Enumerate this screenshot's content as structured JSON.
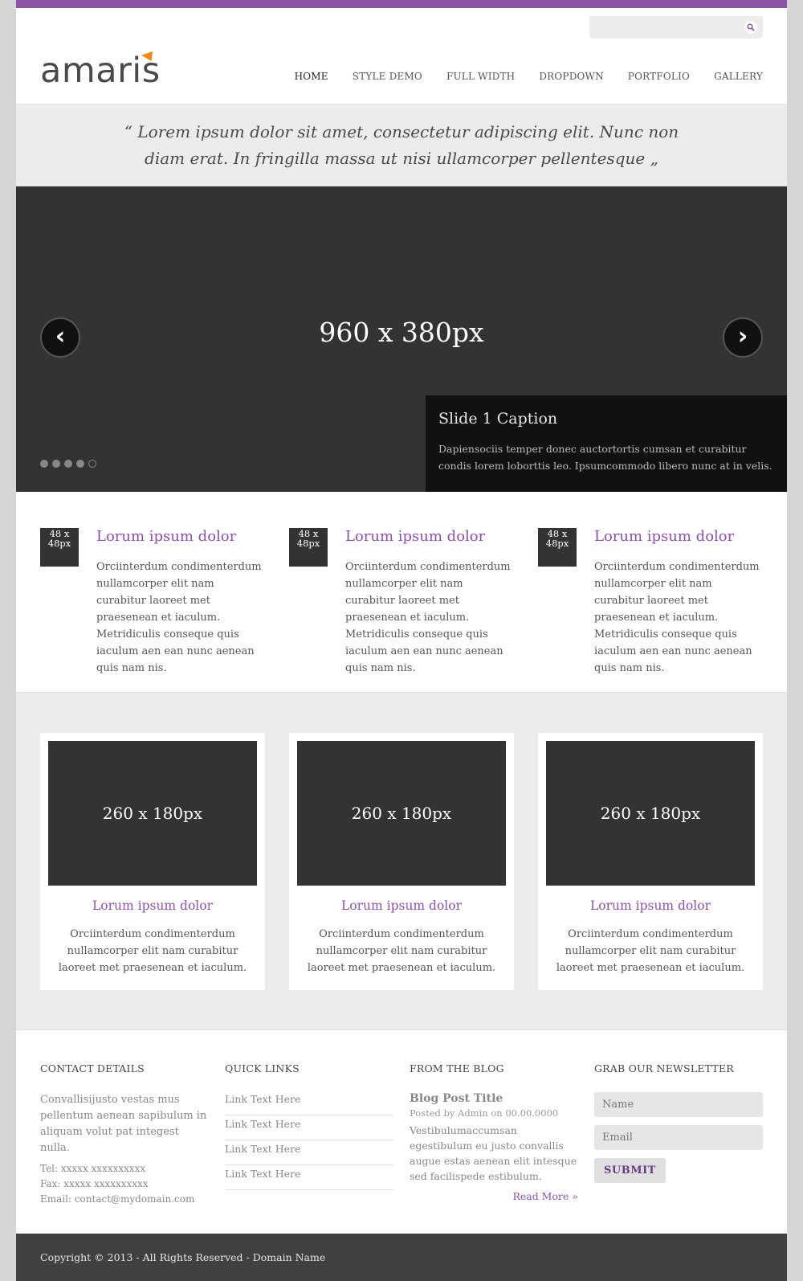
{
  "header": {
    "logo_text": "amaris",
    "nav": [
      "HOME",
      "STYLE DEMO",
      "FULL WIDTH",
      "DROPDOWN",
      "PORTFOLIO",
      "GALLERY"
    ],
    "active_nav": "HOME"
  },
  "quote": "“ Lorem ipsum dolor sit amet, consectetur adipiscing elit. Nunc non diam erat. In fringilla massa ut nisi ullamcorper pellentesque „",
  "slider": {
    "image_label": "960 x 380px",
    "caption_title": "Slide 1 Caption",
    "caption_text": "Dapiensociis temper donec auctortortis cumsan et curabitur condis lorem loborttis leo. Ipsumcommodo libero nunc at in velis.",
    "prev_glyph": "‹",
    "next_glyph": "›",
    "dot_count": 5,
    "active_dot": 5
  },
  "features": [
    {
      "thumb": "48 x 48px",
      "title": "Lorum ipsum dolor",
      "text": "Orciinterdum condimenterdum nullamcorper elit nam curabitur laoreet met praesenean et iaculum. Metridiculis conseque quis iaculum aen ean nunc aenean quis nam nis."
    },
    {
      "thumb": "48 x 48px",
      "title": "Lorum ipsum dolor",
      "text": "Orciinterdum condimenterdum nullamcorper elit nam curabitur laoreet met praesenean et iaculum. Metridiculis conseque quis iaculum aen ean nunc aenean quis nam nis."
    },
    {
      "thumb": "48 x 48px",
      "title": "Lorum ipsum dolor",
      "text": "Orciinterdum condimenterdum nullamcorper elit nam curabitur laoreet met praesenean et iaculum. Metridiculis conseque quis iaculum aen ean nunc aenean quis nam nis."
    }
  ],
  "portfolio": [
    {
      "image_label": "260 x 180px",
      "title": "Lorum ipsum dolor",
      "text": "Orciinterdum condimenterdum nullamcorper elit nam curabitur laoreet met praesenean et iaculum."
    },
    {
      "image_label": "260 x 180px",
      "title": "Lorum ipsum dolor",
      "text": "Orciinterdum condimenterdum nullamcorper elit nam curabitur laoreet met praesenean et iaculum."
    },
    {
      "image_label": "260 x 180px",
      "title": "Lorum ipsum dolor",
      "text": "Orciinterdum condimenterdum nullamcorper elit nam curabitur laoreet met praesenean et iaculum."
    }
  ],
  "footer": {
    "contact": {
      "heading": "CONTACT DETAILS",
      "text": "Convallisijusto vestas mus pellentum aenean sapibulum in aliquam volut pat integest nulla.",
      "tel": "Tel: xxxxx xxxxxxxxxx",
      "fax": "Fax: xxxxx xxxxxxxxxx",
      "email": "Email: contact@mydomain.com"
    },
    "quick_links": {
      "heading": "QUICK LINKS",
      "links": [
        "Link Text Here",
        "Link Text Here",
        "Link Text Here",
        "Link Text Here"
      ]
    },
    "blog": {
      "heading": "FROM THE BLOG",
      "post_title": "Blog Post Title",
      "meta": "Posted by Admin on 00.00.0000",
      "excerpt": "Vestibulumaccumsan egestibulum eu justo convallis augue estas aenean elit intesque sed facilispede estibulum.",
      "read_more": "Read More »"
    },
    "newsletter": {
      "heading": "GRAB OUR NEWSLETTER",
      "name_placeholder": "Name",
      "email_placeholder": "Email",
      "submit_label": "SUBMIT"
    }
  },
  "copyright": "Copyright © 2013 - All Rights Reserved - Domain Name",
  "colors": {
    "accent": "#8c53a6",
    "logo_flag": "#f08a12",
    "dark": "#333333",
    "footer_bar": "#404040"
  }
}
